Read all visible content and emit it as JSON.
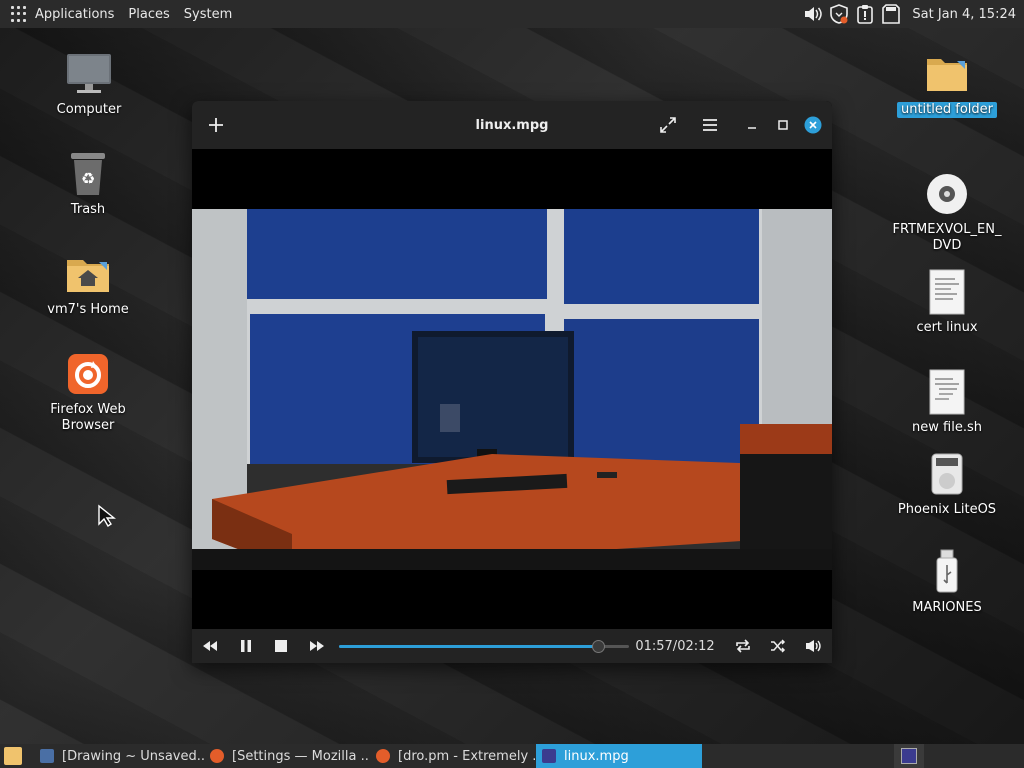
{
  "top_panel": {
    "menus": [
      "Applications",
      "Places",
      "System"
    ],
    "clock": "Sat Jan  4, 15:24"
  },
  "desktop_left": [
    {
      "label": "Computer",
      "icon": "monitor-icon"
    },
    {
      "label": "Trash",
      "icon": "trash-icon"
    },
    {
      "label": "vm7's Home",
      "icon": "home-folder-icon"
    },
    {
      "label": "Firefox Web Browser",
      "icon": "firefox-icon"
    }
  ],
  "desktop_right": [
    {
      "label": "untitled folder",
      "icon": "folder-icon",
      "selected": true
    },
    {
      "label": "FRTMEXVOL_EN_\nDVD",
      "icon": "dvd-icon"
    },
    {
      "label": "cert linux",
      "icon": "text-file-icon"
    },
    {
      "label": "new file.sh",
      "icon": "script-file-icon"
    },
    {
      "label": "Phoenix LiteOS",
      "icon": "drive-icon"
    },
    {
      "label": "MARIONES",
      "icon": "usb-icon"
    }
  ],
  "player": {
    "title": "linux.mpg",
    "elapsed": "01:57",
    "total": "02:12",
    "time_text": "01:57/02:12",
    "progress": 0.886
  },
  "taskbar": {
    "items": [
      {
        "label": "[Drawing ~ Unsaved...",
        "active": false
      },
      {
        "label": "[Settings — Mozilla ...",
        "active": false
      },
      {
        "label": "[dro.pm - Extremely ...",
        "active": false
      },
      {
        "label": "linux.mpg",
        "active": true
      }
    ]
  },
  "colors": {
    "accent": "#2d9fd9",
    "panel": "#2b2b2b",
    "window_header": "#232323"
  }
}
